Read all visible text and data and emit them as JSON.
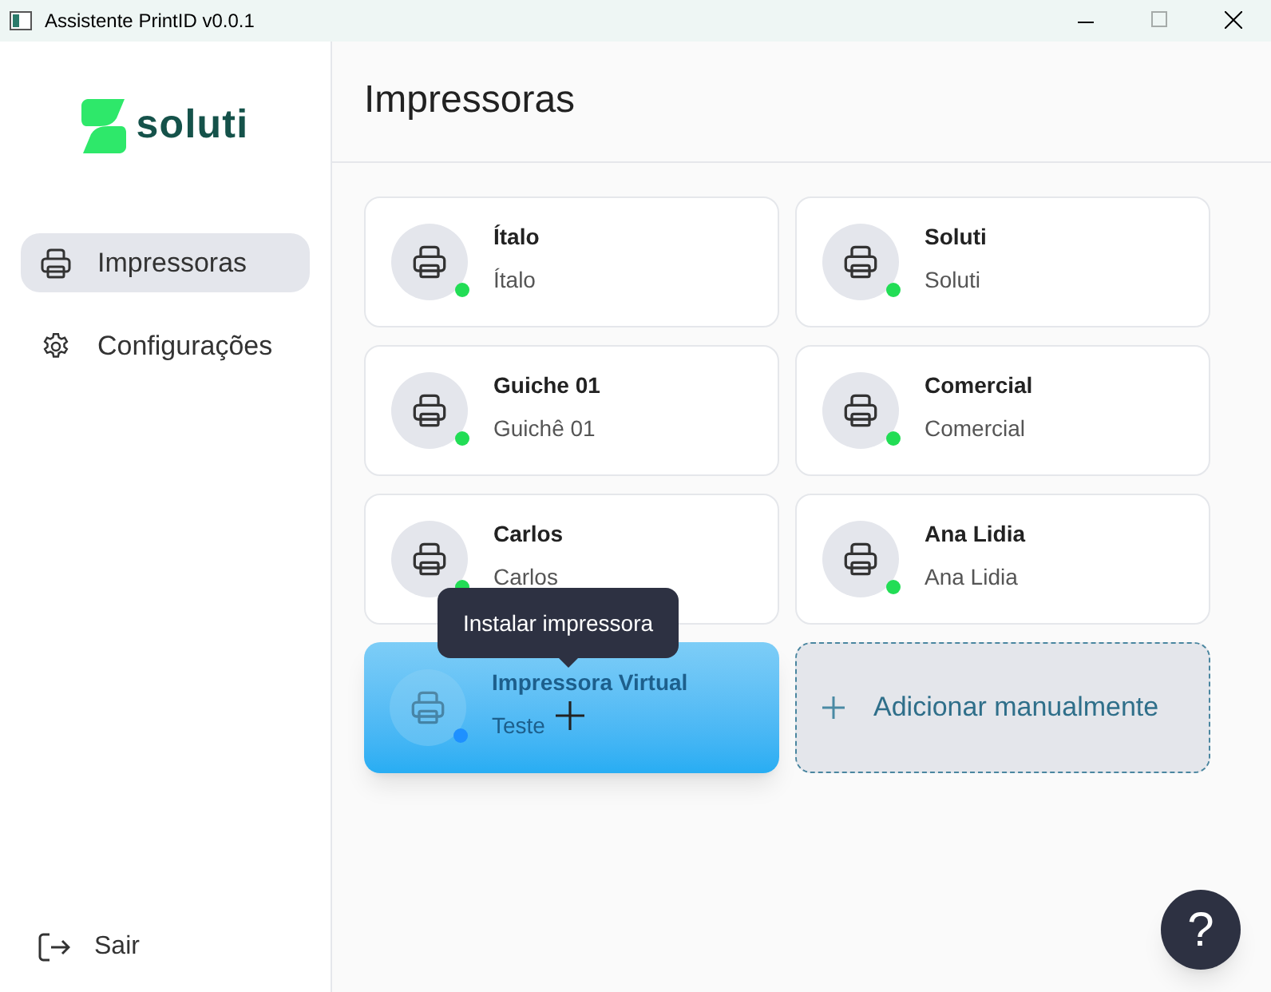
{
  "window": {
    "title": "Assistente PrintID v0.0.1",
    "maximize_disabled": true
  },
  "logo": {
    "text": "soluti"
  },
  "sidebar": {
    "items": [
      {
        "label": "Impressoras",
        "selected": true
      },
      {
        "label": "Configurações",
        "selected": false
      }
    ],
    "logout": {
      "label": "Sair"
    }
  },
  "page": {
    "title": "Impressoras"
  },
  "printers": [
    {
      "kind": "printer",
      "name": "Ítalo",
      "description": "Ítalo",
      "color": "#22dd55"
    },
    {
      "kind": "printer",
      "name": "Soluti",
      "description": "Soluti",
      "color": "#22dd55"
    },
    {
      "kind": "printer",
      "name": "Guiche 01",
      "description": "Guichê 01",
      "color": "#22dd55"
    },
    {
      "kind": "printer",
      "name": "Comercial",
      "description": "Comercial",
      "color": "#22dd55"
    },
    {
      "kind": "printer",
      "name": "Carlos",
      "description": "Carlos",
      "color": "#22dd55"
    },
    {
      "kind": "printer",
      "name": "Ana Lidia",
      "description": "Ana Lidia",
      "color": "#22dd55"
    },
    {
      "kind": "virtual",
      "name": "Impressora Virtual",
      "description": "Teste",
      "color": "#1e90ff",
      "tooltip": "Instalar impressora"
    },
    {
      "kind": "add",
      "label": "Adicionar manualmente"
    }
  ],
  "help_button": {
    "label": "?"
  }
}
